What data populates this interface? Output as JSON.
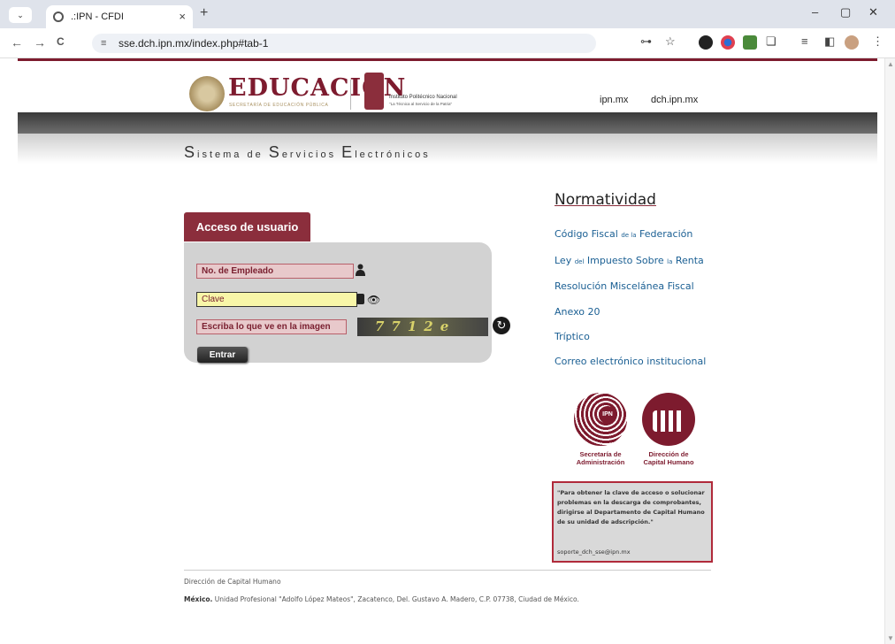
{
  "browser": {
    "tab_title": ".:IPN - CFDI",
    "tab_close": "×",
    "new_tab": "+",
    "tabs_menu": "⌄",
    "url": "sse.dch.ipn.mx/index.php#tab-1",
    "win_min": "–",
    "win_max": "▢",
    "win_close": "✕",
    "back": "←",
    "forward": "→",
    "reload": "C",
    "site_info": "≡",
    "key": "⊶",
    "star": "☆",
    "reading": "≡",
    "sidepanel": "◧",
    "menu": "⋮",
    "extensions": "❏"
  },
  "header": {
    "edu_title": "EDUCACIÓN",
    "edu_sub": "SECRETARÍA DE EDUCACIÓN PÚBLICA",
    "ipn_name": "Instituto Politécnico Nacional",
    "ipn_tag": "\"La Técnica al Servicio de la Patria\"",
    "links": [
      "ipn.mx",
      "dch.ipn.mx"
    ]
  },
  "system_title": {
    "w1_cap": "S",
    "w1_rest": "istema",
    "w2": "de",
    "w3_cap": "S",
    "w3_rest": "ervicios",
    "w4_cap": "E",
    "w4_rest": "lectrónicos"
  },
  "login": {
    "tab_label": "Acceso de usuario",
    "employee_placeholder": "No. de Empleado",
    "password_placeholder": "Clave",
    "captcha_placeholder": "Escriba lo que ve en la imagen",
    "captcha_text": "7712e",
    "submit": "Entrar",
    "eye_icon": "👁",
    "refresh_icon": "↻"
  },
  "normatividad": {
    "title": "Normatividad",
    "links": [
      [
        "Código Fiscal ",
        "de la",
        " Federación"
      ],
      [
        "Ley ",
        "del",
        " Impuesto Sobre ",
        "la",
        " Renta"
      ],
      "Resolución Miscelánea Fiscal",
      "Anexo 20",
      "Tríptico",
      "Correo electrónico institucional"
    ]
  },
  "logos": {
    "sa_core": "IPN",
    "sa_caption_1": "Secretaría de",
    "sa_caption_2": "Administración",
    "ch_caption_1": "Dirección de",
    "ch_caption_2": "Capital Humano"
  },
  "note": {
    "text": "\"Para obtener la clave de acceso o solucionar problemas en la descarga de comprobantes, dirigirse al Departamento de Capital Humano de su unidad de adscripción.\"",
    "email": "soporte_dch_sse@ipn.mx"
  },
  "footer": {
    "line1": "Dirección de Capital Humano",
    "line2_bold": "México.",
    "line2_rest": " Unidad Profesional \"Adolfo López Mateos\", Zacatenco, Del. Gustavo A. Madero, C.P. 07738, Ciudad de México."
  },
  "colors": {
    "brand": "#7d1b2e",
    "tab_bg": "#8b2e3c",
    "link": "#1a5f93",
    "input_bg": "#e8c9cb",
    "input_active": "#f8f6a8"
  }
}
